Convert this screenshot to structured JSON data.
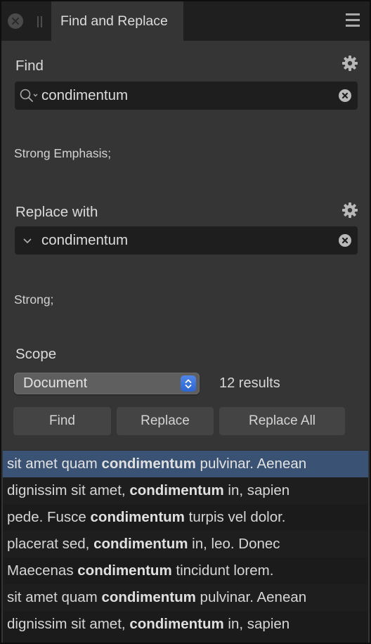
{
  "tabbar": {
    "close_icon": "close-circle-icon",
    "grip_icon": "drag-grip-icon",
    "tab_title": "Find and Replace",
    "menu_icon": "hamburger-menu-icon"
  },
  "find": {
    "label": "Find",
    "settings_icon": "gear-icon",
    "search_icon": "search-options-icon",
    "value": "condimentum",
    "clear_icon": "clear-circle-icon",
    "format": "Strong Emphasis;"
  },
  "replace": {
    "label": "Replace with",
    "settings_icon": "gear-icon",
    "dropdown_icon": "chevron-down-icon",
    "value": "condimentum",
    "clear_icon": "clear-circle-icon",
    "format": "Strong;"
  },
  "scope": {
    "label": "Scope",
    "selected": "Document",
    "results_count": "12 results"
  },
  "buttons": {
    "find": "Find",
    "replace": "Replace",
    "replace_all": "Replace All"
  },
  "results": [
    {
      "before": "sit amet quam ",
      "match": "condimentum",
      "after": " pulvinar. Aenean",
      "selected": true
    },
    {
      "before": "dignissim sit amet, ",
      "match": "condimentum",
      "after": " in, sapien",
      "selected": false
    },
    {
      "before": "pede. Fusce ",
      "match": "condimentum",
      "after": " turpis vel dolor.",
      "selected": false
    },
    {
      "before": "placerat sed, ",
      "match": "condimentum",
      "after": " in, leo. Donec",
      "selected": false
    },
    {
      "before": "Maecenas ",
      "match": "condimentum",
      "after": " tincidunt lorem.",
      "selected": false
    },
    {
      "before": "sit amet quam ",
      "match": "condimentum",
      "after": " pulvinar. Aenean",
      "selected": false
    },
    {
      "before": "dignissim sit amet, ",
      "match": "condimentum",
      "after": " in, sapien",
      "selected": false
    }
  ],
  "colors": {
    "panel_bg": "#353535",
    "field_bg": "#1e1e1e",
    "selection": "#3a5273",
    "accent_blue": "#3a74dc"
  }
}
